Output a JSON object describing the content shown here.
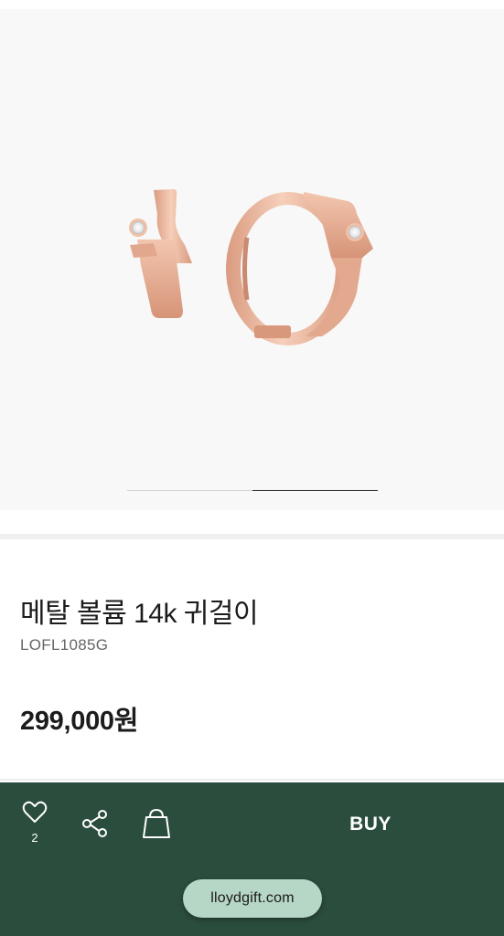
{
  "product": {
    "name": "메탈 볼륨 14k 귀걸이",
    "code": "LOFL1085G",
    "price": "299,000원",
    "image_alt": "rose gold hoop earrings with stone"
  },
  "gallery": {
    "slides_total": 2,
    "active_slide": 2
  },
  "bottom_bar": {
    "like_count": "2",
    "buy_label": "BUY",
    "icons": [
      "heart-icon",
      "share-icon",
      "shopping-bag-icon"
    ]
  },
  "browser": {
    "url": "lloydgift.com"
  },
  "colors": {
    "bottom_bar": "#2b4d3d",
    "url_pill": "#b6d6c6",
    "metal": "#e8b59c"
  }
}
